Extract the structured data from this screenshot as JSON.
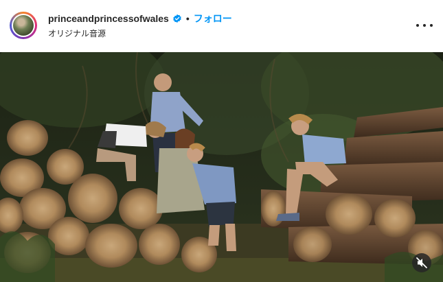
{
  "post_header": {
    "username": "princeandprincessofwales",
    "separator": "•",
    "follow_label": "フォロー",
    "audio_label": "オリジナル音源"
  },
  "colors": {
    "follow_blue": "#0095f6",
    "verified_blue": "#0095f6",
    "text": "#262626"
  },
  "icons": {
    "verified": "verified-badge-icon",
    "more": "more-options-icon",
    "mute": "sound-off-icon"
  }
}
